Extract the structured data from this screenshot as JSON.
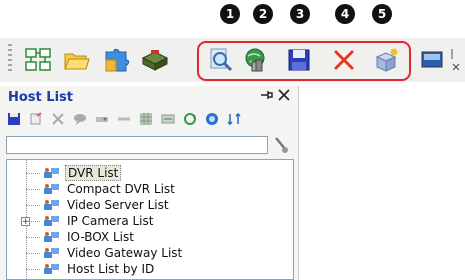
{
  "callouts": [
    "1",
    "2",
    "3",
    "4",
    "5"
  ],
  "toolbar": {
    "buttons": [
      {
        "icon": "host-tree-icon"
      },
      {
        "icon": "folder-icon"
      },
      {
        "icon": "puzzle-icon"
      },
      {
        "icon": "device-icon"
      },
      {
        "icon": "search-icon"
      },
      {
        "icon": "network-icon"
      },
      {
        "icon": "save-icon"
      },
      {
        "icon": "delete-icon"
      },
      {
        "icon": "new-icon"
      },
      {
        "icon": "monitor-icon"
      }
    ],
    "highlight_color": "#e0282e"
  },
  "host_list": {
    "title": "Host List",
    "tree": [
      {
        "label": "DVR List",
        "selected": true
      },
      {
        "label": "Compact DVR List"
      },
      {
        "label": "Video Server List"
      },
      {
        "label": "IP Camera List",
        "expander": "+"
      },
      {
        "label": "IO-BOX List"
      },
      {
        "label": "Video Gateway List"
      },
      {
        "label": "Host List by ID"
      }
    ]
  },
  "colors": {
    "title": "#1c3aa8",
    "selected_bg": "#e9e6da"
  }
}
